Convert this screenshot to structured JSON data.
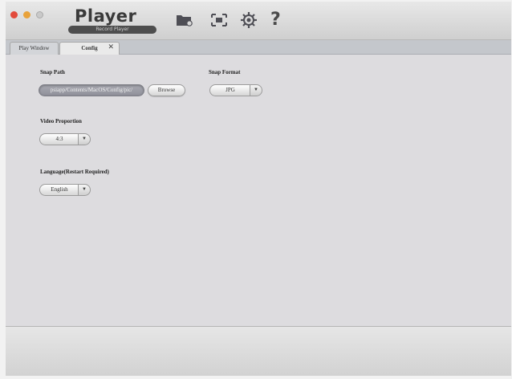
{
  "app": {
    "title": "Player",
    "subtitle": "Record Player"
  },
  "toolbar": {
    "icons": [
      "folder-icon",
      "fullscreen-icon",
      "gear-icon",
      "help-icon"
    ],
    "help_glyph": "?"
  },
  "tabs": [
    {
      "label": "Play Window",
      "active": false
    },
    {
      "label": "Config",
      "active": true,
      "close_glyph": "✕"
    }
  ],
  "config": {
    "snap_path": {
      "label": "Snap Path",
      "value": "psiapp/Contents/MacOS/Config/pic/",
      "browse_label": "Browse"
    },
    "snap_format": {
      "label": "Snap Format",
      "value": "JPG"
    },
    "video_proportion": {
      "label": "Video Proportion",
      "value": "4:3"
    },
    "language": {
      "label": "Language(Restart Required)",
      "value": "English"
    }
  },
  "colors": {
    "close": "#e24b3c",
    "minimize": "#e8a23a",
    "content_bg": "#dddcdf",
    "tab_bar": "#c4c7cc"
  }
}
